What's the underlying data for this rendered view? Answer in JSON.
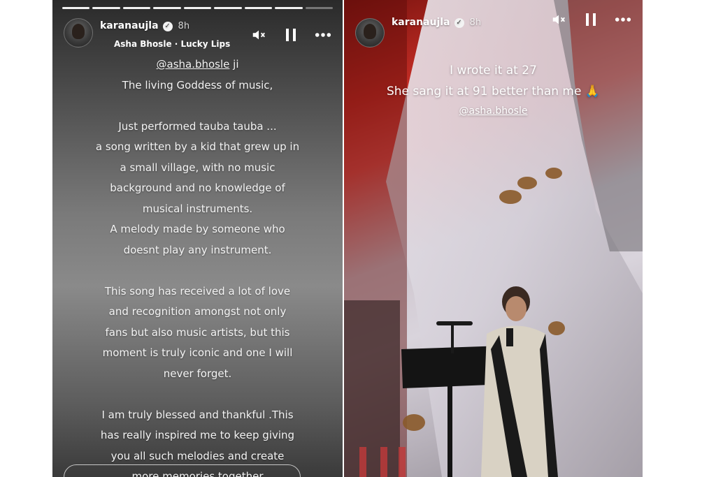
{
  "left_story": {
    "username": "karanaujla",
    "time": "8h",
    "music": "Asha Bhosle · Lucky Lips",
    "mention": "@asha.bhosle",
    "mention_suffix": " ji",
    "lines": [
      "The living Goddess of music,",
      "",
      "Just performed tauba tauba ...",
      "a song written by a kid that grew up in",
      "a small village, with no music",
      "background and no knowledge of",
      "musical instruments.",
      "A melody made by someone who",
      "doesnt play any instrument.",
      "",
      "This song has received a lot of love",
      "and recognition amongst not only",
      "fans but also music artists, but this",
      "moment is truly iconic and one I will",
      "never forget.",
      "",
      "I am truly blessed and thankful  .This",
      "has really inspired me to keep giving",
      "you all such melodies and create",
      "more memories together"
    ]
  },
  "right_story": {
    "username": "karanaujla",
    "time": "8h",
    "caption_line1": "I wrote it at 27",
    "caption_line2": "She sang it at 91 better than me 🙏",
    "mention": "@asha.bhosle"
  },
  "icons": {
    "verified": "verified-badge-icon",
    "mute": "speaker-muted-icon",
    "pause": "pause-icon",
    "more": "more-options-icon"
  }
}
